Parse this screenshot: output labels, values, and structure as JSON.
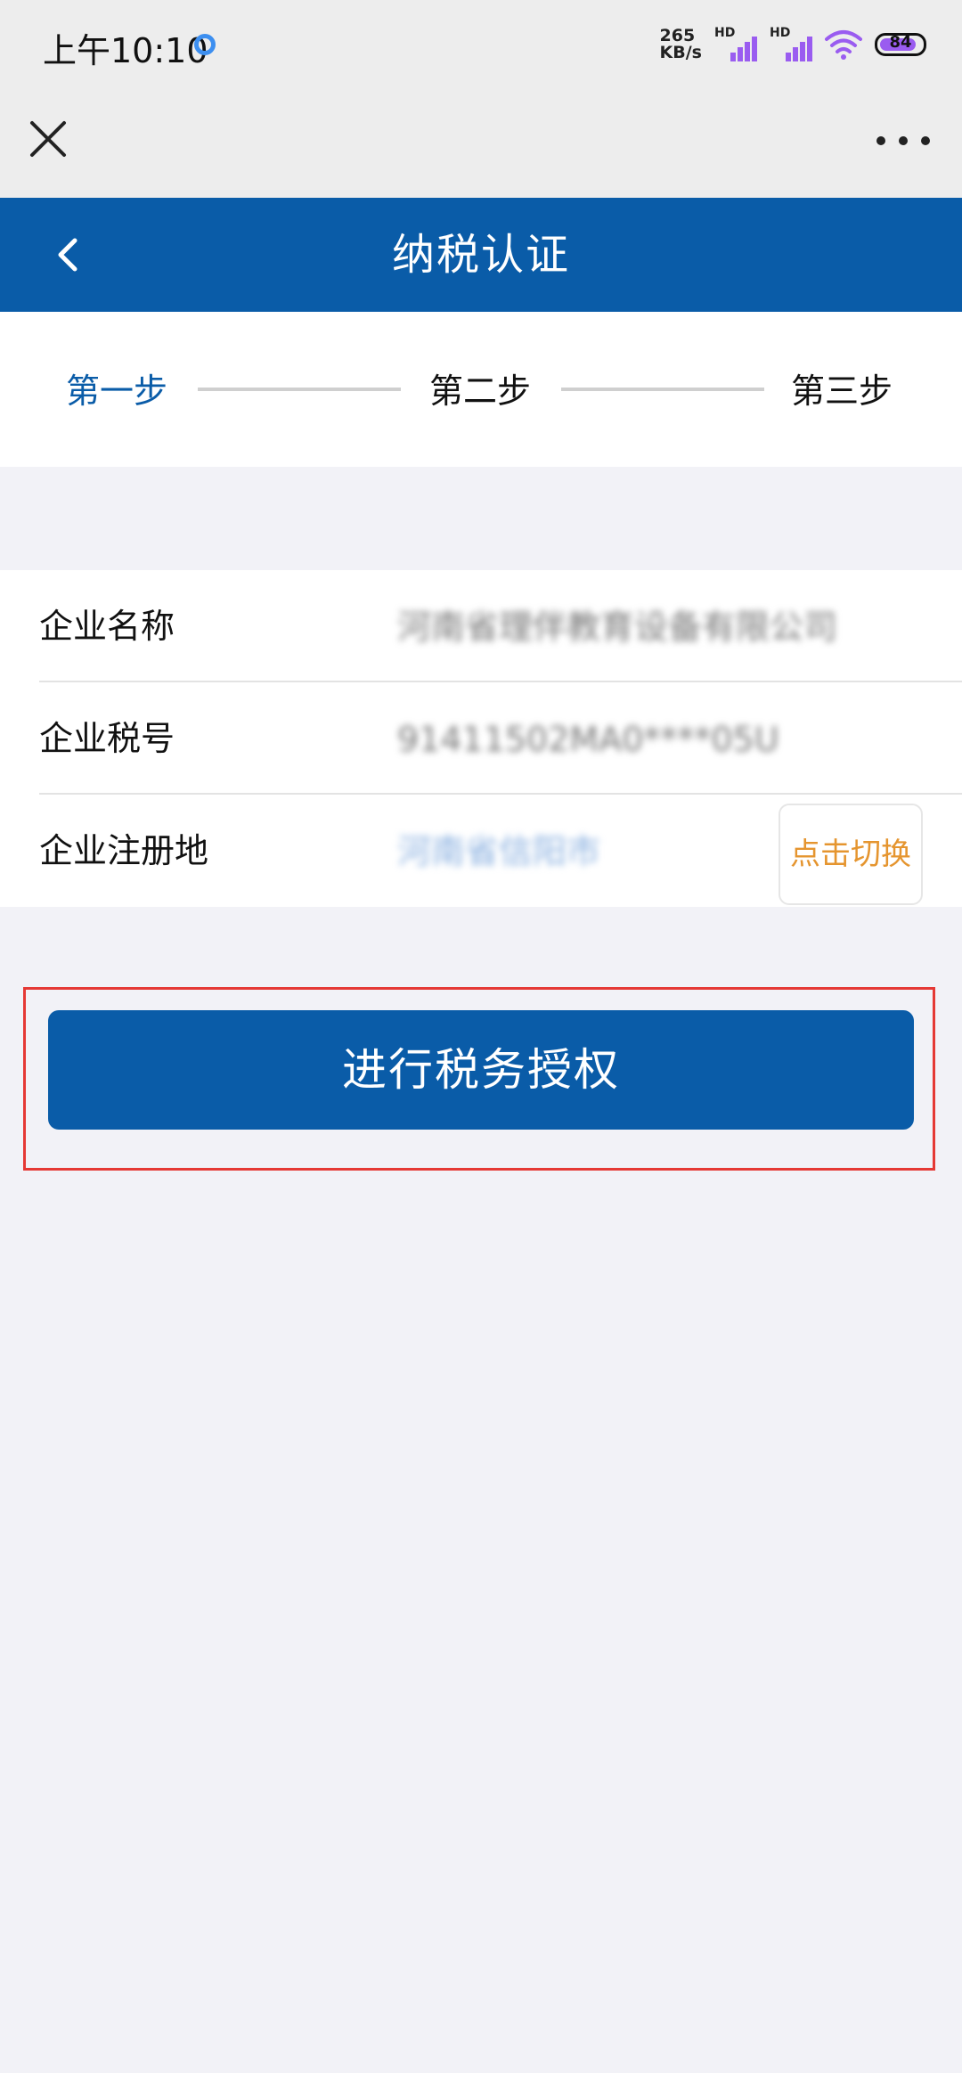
{
  "status_bar": {
    "time": "上午10:10",
    "net_speed_value": "265",
    "net_speed_unit": "KB/s",
    "signal_label_1": "HD",
    "signal_label_2": "HD",
    "battery": "84",
    "accent_color": "#9a5cf0"
  },
  "top_bar": {
    "close_icon": "close-icon",
    "more_icon": "more-icon"
  },
  "header": {
    "title": "纳税认证",
    "back_icon": "chevron-left-icon",
    "color": "#0a5ca8"
  },
  "steps": {
    "items": [
      {
        "label": "第一步",
        "active": true
      },
      {
        "label": "第二步",
        "active": false
      },
      {
        "label": "第三步",
        "active": false
      }
    ]
  },
  "company": {
    "rows": [
      {
        "label": "企业名称",
        "value": "河南省理伴教育设备有限公司"
      },
      {
        "label": "企业税号",
        "value": "91411502MA0****05U"
      },
      {
        "label": "企业注册地",
        "value": "河南省信阳市"
      }
    ],
    "switch_label": "点击切换"
  },
  "auth_button": {
    "label": "进行税务授权"
  }
}
